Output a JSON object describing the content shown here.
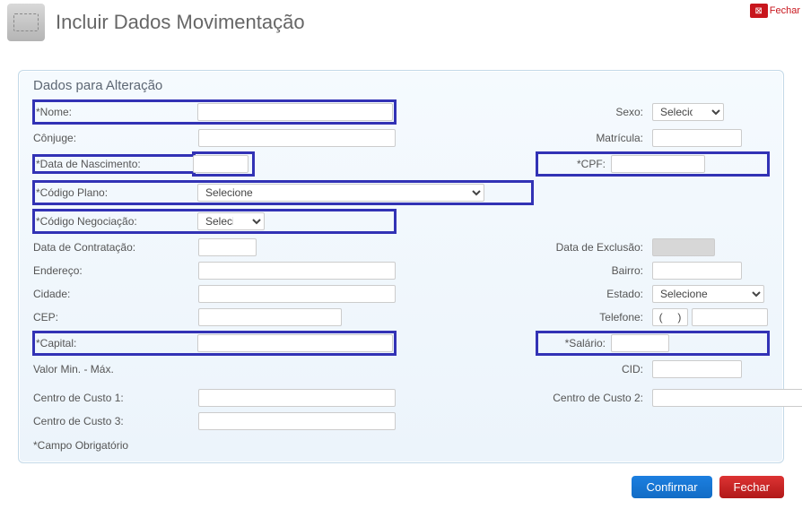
{
  "header": {
    "title": "Incluir Dados Movimentação",
    "close_btn": "Fechar"
  },
  "panel": {
    "title": "Dados para Alteração",
    "labels": {
      "nome": "*Nome:",
      "sexo": "Sexo:",
      "conjuge": "Cônjuge:",
      "matricula": "Matrícula:",
      "data_nascimento": "*Data de Nascimento:",
      "cpf": "*CPF:",
      "codigo_plano": "*Código Plano:",
      "codigo_negociacao": "*Código Negociação:",
      "data_contratacao": "Data de Contratação:",
      "data_exclusao": "Data de Exclusão:",
      "endereco": "Endereço:",
      "bairro": "Bairro:",
      "cidade": "Cidade:",
      "estado": "Estado:",
      "cep": "CEP:",
      "telefone": "Telefone:",
      "capital": "*Capital:",
      "salario": "*Salário:",
      "valor_min_max": "Valor Min. - Máx.",
      "cid": "CID:",
      "centro_custo_1": "Centro de Custo 1:",
      "centro_custo_2": "Centro de Custo 2:",
      "centro_custo_3": "Centro de Custo 3:",
      "obrigatorio": "*Campo Obrigatório"
    },
    "selects": {
      "selecione": "Selecione"
    },
    "phone": {
      "ddd": "(     )"
    }
  },
  "footer": {
    "confirm": "Confirmar",
    "close": "Fechar"
  }
}
